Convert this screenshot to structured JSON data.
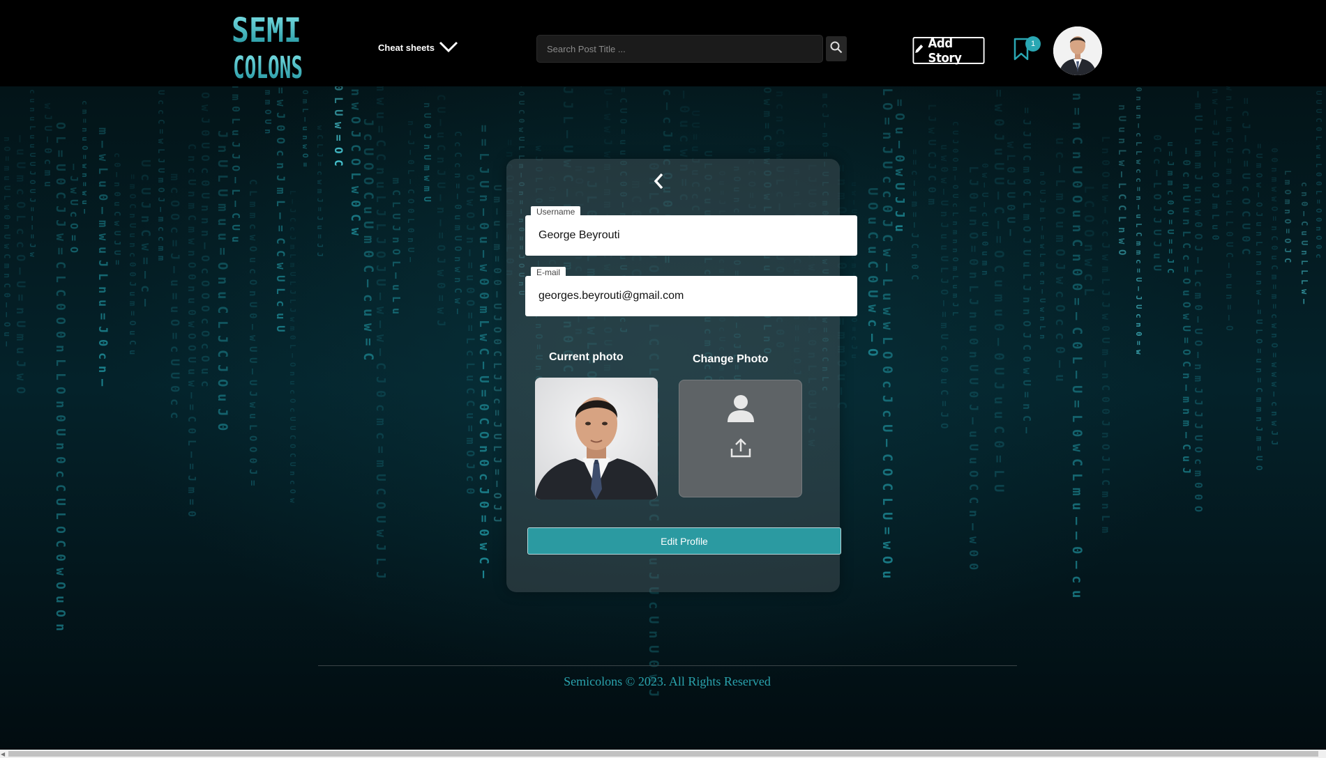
{
  "header": {
    "logo_line1": "SEMI",
    "logo_line2": "COLONS",
    "menu_label": "Cheat sheets",
    "search": {
      "placeholder": "Search Post Title ...",
      "value": ""
    },
    "add_story_label": "Add Story",
    "notification_count": "1"
  },
  "profile_form": {
    "username_label": "Username",
    "username_value": "George Beyrouti",
    "email_label": "E-mail",
    "email_value": "georges.beyrouti@gmail.com",
    "current_photo_title": "Current photo",
    "change_photo_title": "Change Photo",
    "submit_label": "Edit Profile"
  },
  "footer": {
    "text": "Semicolons © 2023. All Rights Reserved"
  },
  "colors": {
    "accent": "#2b9aa1",
    "footer_text": "#2aa3ad",
    "background": "#000000"
  }
}
